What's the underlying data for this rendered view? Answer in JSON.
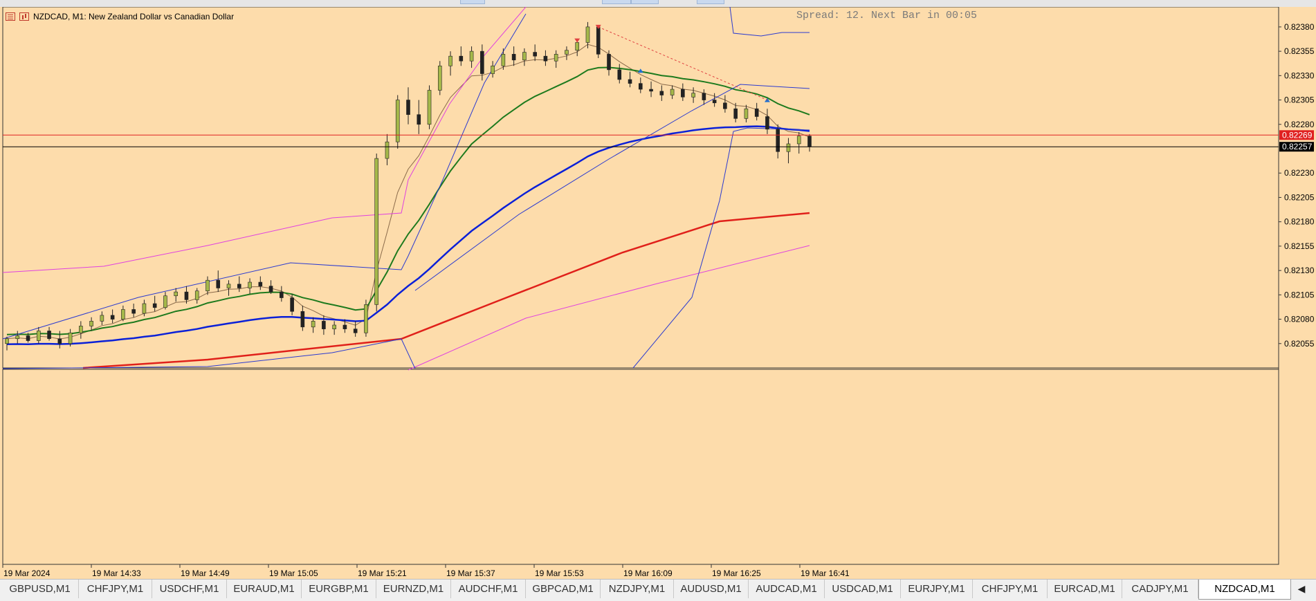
{
  "window": {
    "symbol_title": "NZDCAD, M1:  New Zealand Dollar vs Canadian Dollar",
    "spread_text": "Spread: 12. Next Bar in 00:05",
    "title_icons": [
      "menu-icon",
      "chart-icon"
    ]
  },
  "colors": {
    "background": "#fddcab",
    "bullish_candle": "#a5b84a",
    "bearish_candle": "#222222",
    "ema_slow": "#e0201a",
    "ema_mid": "#0a20d8",
    "ema_fast": "#1d7a1d",
    "ema_short": "#8a6a4a",
    "bollinger_blue": "#2a3ad0",
    "envelope_magenta": "#e040e0",
    "bid_line": "#000000",
    "ask_line": "#e02020"
  },
  "price_axis": {
    "labels": [
      "0.82380",
      "0.82355",
      "0.82330",
      "0.82305",
      "0.82280",
      "0.82230",
      "0.82205",
      "0.82180",
      "0.82155",
      "0.82130",
      "0.82105",
      "0.82080",
      "0.82055"
    ],
    "ask_label": "0.82269",
    "bid_label": "0.82257"
  },
  "time_axis": {
    "labels": [
      "19 Mar 2024",
      "19 Mar 14:33",
      "19 Mar 14:49",
      "19 Mar 15:05",
      "19 Mar 15:21",
      "19 Mar 15:37",
      "19 Mar 15:53",
      "19 Mar 16:09",
      "19 Mar 16:25",
      "19 Mar 16:41"
    ]
  },
  "chart_data": {
    "type": "candlestick",
    "symbol": "NZDCAD",
    "timeframe": "M1",
    "ylim": [
      0.8203,
      0.8239
    ],
    "grid": false,
    "ask": 0.82269,
    "bid": 0.82257,
    "candles": [
      [
        0.82055,
        0.82062,
        0.82048,
        0.8206
      ],
      [
        0.8206,
        0.82068,
        0.82055,
        0.82063
      ],
      [
        0.82063,
        0.82066,
        0.82056,
        0.82058
      ],
      [
        0.82058,
        0.82072,
        0.82055,
        0.82068
      ],
      [
        0.82068,
        0.82072,
        0.82058,
        0.8206
      ],
      [
        0.8206,
        0.82068,
        0.8205,
        0.82055
      ],
      [
        0.82055,
        0.8207,
        0.82052,
        0.82066
      ],
      [
        0.82066,
        0.82078,
        0.8206,
        0.82073
      ],
      [
        0.82073,
        0.82082,
        0.82068,
        0.82078
      ],
      [
        0.82078,
        0.82088,
        0.82074,
        0.82084
      ],
      [
        0.82084,
        0.8209,
        0.82076,
        0.8208
      ],
      [
        0.8208,
        0.82094,
        0.82078,
        0.8209
      ],
      [
        0.8209,
        0.82096,
        0.82082,
        0.82086
      ],
      [
        0.82086,
        0.821,
        0.82083,
        0.82096
      ],
      [
        0.82096,
        0.82104,
        0.82088,
        0.82092
      ],
      [
        0.82092,
        0.82108,
        0.8209,
        0.82104
      ],
      [
        0.82104,
        0.82112,
        0.82098,
        0.82108
      ],
      [
        0.82108,
        0.82114,
        0.82096,
        0.821
      ],
      [
        0.821,
        0.82112,
        0.82096,
        0.82109
      ],
      [
        0.82109,
        0.82124,
        0.82105,
        0.8212
      ],
      [
        0.8212,
        0.8213,
        0.82108,
        0.82112
      ],
      [
        0.82112,
        0.8212,
        0.82104,
        0.82116
      ],
      [
        0.82116,
        0.82124,
        0.82108,
        0.82112
      ],
      [
        0.82112,
        0.82122,
        0.82106,
        0.82118
      ],
      [
        0.82118,
        0.82124,
        0.8211,
        0.82114
      ],
      [
        0.82114,
        0.8212,
        0.82106,
        0.82108
      ],
      [
        0.82108,
        0.82114,
        0.82098,
        0.82102
      ],
      [
        0.82102,
        0.82106,
        0.82084,
        0.82088
      ],
      [
        0.82088,
        0.82094,
        0.82068,
        0.82072
      ],
      [
        0.82072,
        0.82082,
        0.82066,
        0.82078
      ],
      [
        0.82078,
        0.82084,
        0.82064,
        0.8207
      ],
      [
        0.8207,
        0.82078,
        0.82064,
        0.82074
      ],
      [
        0.82074,
        0.8208,
        0.82066,
        0.8207
      ],
      [
        0.8207,
        0.82078,
        0.82062,
        0.82066
      ],
      [
        0.82066,
        0.821,
        0.82062,
        0.82095
      ],
      [
        0.82095,
        0.8225,
        0.82088,
        0.82245
      ],
      [
        0.82245,
        0.8227,
        0.82238,
        0.82262
      ],
      [
        0.82262,
        0.8231,
        0.82255,
        0.82305
      ],
      [
        0.82305,
        0.82318,
        0.8228,
        0.8229
      ],
      [
        0.8229,
        0.82305,
        0.8227,
        0.8228
      ],
      [
        0.8228,
        0.8232,
        0.82275,
        0.82315
      ],
      [
        0.82315,
        0.82345,
        0.8231,
        0.8234
      ],
      [
        0.8234,
        0.82355,
        0.8233,
        0.8235
      ],
      [
        0.8235,
        0.8236,
        0.8234,
        0.82345
      ],
      [
        0.82345,
        0.8236,
        0.82338,
        0.82355
      ],
      [
        0.82355,
        0.82362,
        0.82325,
        0.82332
      ],
      [
        0.82332,
        0.82345,
        0.82328,
        0.8234
      ],
      [
        0.8234,
        0.82358,
        0.82336,
        0.82352
      ],
      [
        0.82352,
        0.8236,
        0.8234,
        0.82346
      ],
      [
        0.82346,
        0.82358,
        0.8234,
        0.82354
      ],
      [
        0.82354,
        0.82362,
        0.82345,
        0.8235
      ],
      [
        0.8235,
        0.82356,
        0.8234,
        0.82345
      ],
      [
        0.82345,
        0.82356,
        0.82338,
        0.82352
      ],
      [
        0.82352,
        0.8236,
        0.82346,
        0.82356
      ],
      [
        0.82356,
        0.82368,
        0.8235,
        0.82364
      ],
      [
        0.82364,
        0.82385,
        0.82358,
        0.8238
      ],
      [
        0.8238,
        0.82382,
        0.82348,
        0.82352
      ],
      [
        0.82352,
        0.82356,
        0.8233,
        0.82336
      ],
      [
        0.82336,
        0.82342,
        0.82322,
        0.82326
      ],
      [
        0.82326,
        0.82334,
        0.82318,
        0.82322
      ],
      [
        0.82322,
        0.82328,
        0.82312,
        0.82316
      ],
      [
        0.82316,
        0.82324,
        0.82308,
        0.82314
      ],
      [
        0.82314,
        0.8232,
        0.82304,
        0.8231
      ],
      [
        0.8231,
        0.8232,
        0.82306,
        0.82316
      ],
      [
        0.82316,
        0.82322,
        0.82304,
        0.82308
      ],
      [
        0.82308,
        0.82318,
        0.82302,
        0.82312
      ],
      [
        0.82312,
        0.82316,
        0.823,
        0.82305
      ],
      [
        0.82305,
        0.82312,
        0.82298,
        0.82302
      ],
      [
        0.82302,
        0.8231,
        0.82292,
        0.82296
      ],
      [
        0.82296,
        0.82302,
        0.82282,
        0.82286
      ],
      [
        0.82286,
        0.823,
        0.82282,
        0.82296
      ],
      [
        0.82296,
        0.82302,
        0.82284,
        0.82288
      ],
      [
        0.82288,
        0.82296,
        0.8227,
        0.82275
      ],
      [
        0.82275,
        0.8228,
        0.82245,
        0.82252
      ],
      [
        0.82252,
        0.82266,
        0.8224,
        0.8226
      ],
      [
        0.8226,
        0.82272,
        0.8225,
        0.82268
      ],
      [
        0.82268,
        0.8227,
        0.82252,
        0.82257
      ]
    ],
    "arrows": [
      {
        "type": "sell",
        "price": 0.82366,
        "candle_index": 54
      },
      {
        "type": "sell",
        "price": 0.8238,
        "candle_index": 56
      },
      {
        "type": "buy",
        "price": 0.82335,
        "candle_index": 60
      },
      {
        "type": "buy",
        "price": 0.82305,
        "candle_index": 72
      }
    ]
  },
  "tabs": [
    {
      "label": "GBPUSD,M1"
    },
    {
      "label": "CHFJPY,M1"
    },
    {
      "label": "USDCHF,M1"
    },
    {
      "label": "EURAUD,M1"
    },
    {
      "label": "EURGBP,M1"
    },
    {
      "label": "EURNZD,M1"
    },
    {
      "label": "AUDCHF,M1"
    },
    {
      "label": "GBPCAD,M1"
    },
    {
      "label": "NZDJPY,M1"
    },
    {
      "label": "AUDUSD,M1"
    },
    {
      "label": "AUDCAD,M1"
    },
    {
      "label": "USDCAD,M1"
    },
    {
      "label": "EURJPY,M1"
    },
    {
      "label": "CHFJPY,M1"
    },
    {
      "label": "EURCAD,M1"
    },
    {
      "label": "CADJPY,M1"
    },
    {
      "label": "NZDCAD,M1",
      "active": true
    }
  ],
  "tab_scroll_icon": "◀"
}
